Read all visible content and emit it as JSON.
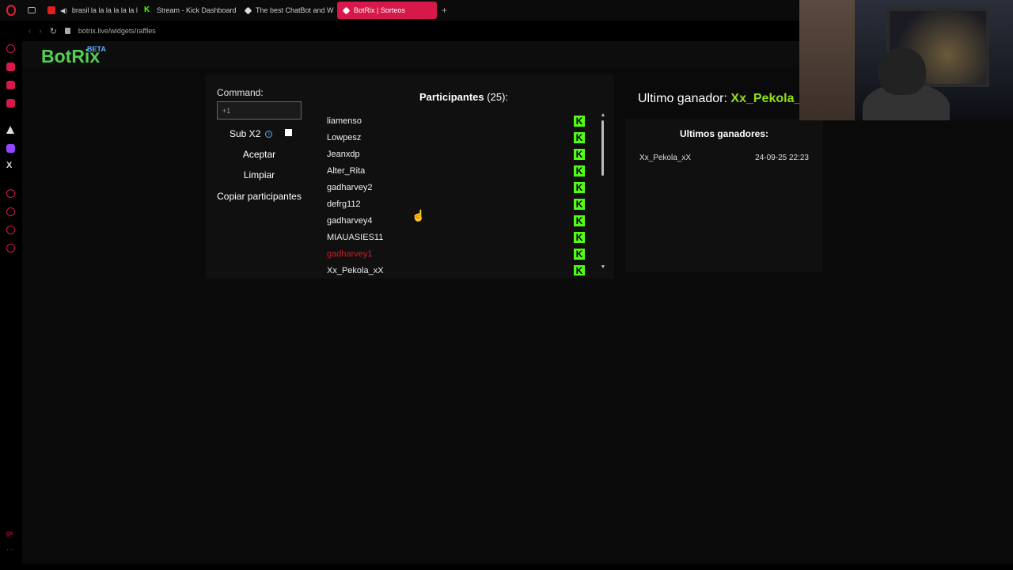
{
  "browser": {
    "tabs": [
      {
        "label": "brasil la la la la la la la",
        "icon": "youtube-icon"
      },
      {
        "label": "Stream - Kick Dashboard",
        "icon": "kick-icon"
      },
      {
        "label": "The best ChatBot and W",
        "icon": "botrix-icon"
      },
      {
        "label": "BotRix | Sorteos",
        "icon": "botrix-icon",
        "active": true
      }
    ],
    "new_tab": "+",
    "url": "botrix.live/widgets/raffles"
  },
  "app": {
    "logo": "BotRix",
    "logo_badge": "BETA"
  },
  "raffle": {
    "command_label": "Command:",
    "command_value": "+1",
    "sub_x2_label": "Sub X2",
    "accept_label": "Aceptar",
    "clear_label": "Limpiar",
    "copy_label": "Copiar participantes",
    "participants_label": "Participantes",
    "participants_count": "(25):",
    "participants": [
      {
        "name": "liamenso"
      },
      {
        "name": "Lowpesz"
      },
      {
        "name": "Jeanxdp"
      },
      {
        "name": "Alter_Rita"
      },
      {
        "name": "gadharvey2"
      },
      {
        "name": "defrg112"
      },
      {
        "name": "gadharvey4"
      },
      {
        "name": "MIAUASIES11"
      },
      {
        "name": "gadharvey1",
        "highlight": true
      },
      {
        "name": "Xx_Pekola_xX"
      }
    ],
    "platform_badge": "K"
  },
  "winners": {
    "last_winner_label": "Ultimo ganador:",
    "last_winner_name": "Xx_Pekola_xX",
    "list_title": "Ultimos ganadores:",
    "list": [
      {
        "name": "Xx_Pekola_xX",
        "date": "24-09-25 22:23"
      }
    ]
  },
  "colors": {
    "accent": "#d6184a",
    "kick_green": "#53fc18",
    "winner_green": "#8fe01a",
    "logo_green": "#53d153",
    "highlight_red": "#c81e2c"
  }
}
